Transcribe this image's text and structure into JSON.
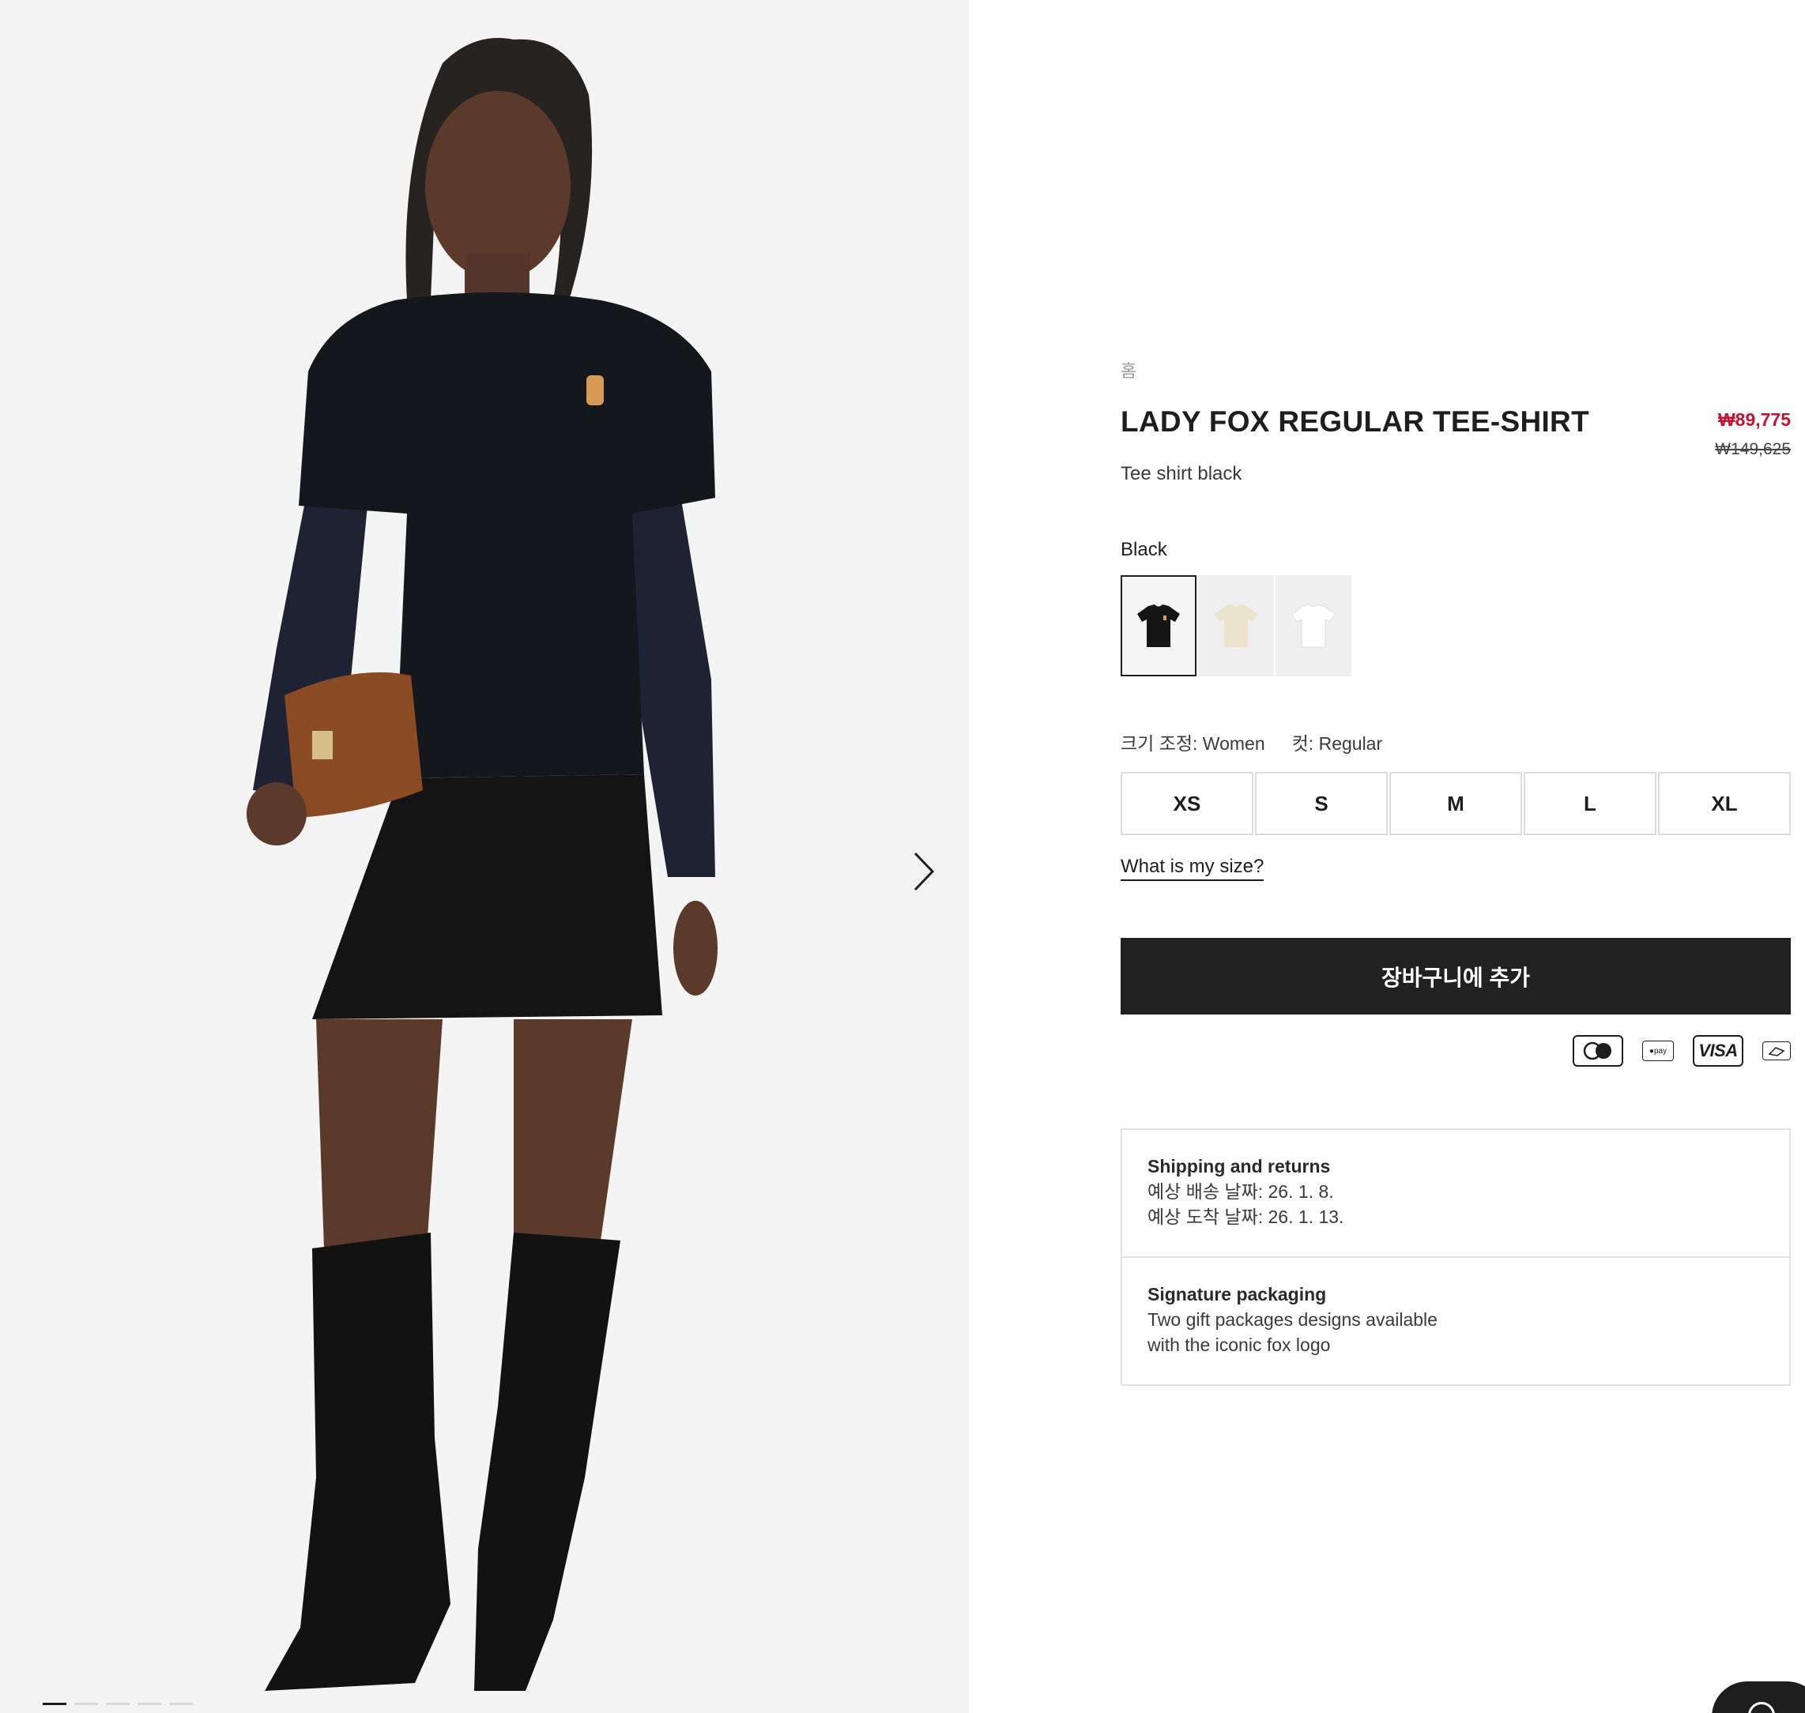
{
  "gallery": {
    "next_icon": "chevron-right-icon",
    "slides_total": 5,
    "active_slide": 1
  },
  "breadcrumb": {
    "home_label": "홈"
  },
  "product": {
    "title": "LADY FOX REGULAR TEE-SHIRT",
    "subtitle": "Tee shirt black",
    "price_sale": "₩89,775",
    "price_original": "₩149,625"
  },
  "color": {
    "selected_label": "Black",
    "swatches": [
      {
        "name": "black",
        "color": "#1a1a1a",
        "selected": true
      },
      {
        "name": "cream",
        "color": "#efe8d6",
        "selected": false
      },
      {
        "name": "white",
        "color": "#ffffff",
        "selected": false
      }
    ]
  },
  "size": {
    "fit_label": "크기 조정: Women",
    "cut_label": "컷: Regular",
    "options": [
      "XS",
      "S",
      "M",
      "L",
      "XL"
    ],
    "help_link": "What is my size?"
  },
  "cta": {
    "add_to_cart": "장바구니에 추가"
  },
  "payments": {
    "visa_label": "VISA",
    "apay_label": "●pay",
    "icons": [
      "mastercard-icon",
      "apple-pay-icon",
      "visa-icon",
      "card-icon"
    ]
  },
  "info": {
    "shipping_title": "Shipping and returns",
    "shipping_line1": "예상 배송 날짜: 26. 1. 8.",
    "shipping_line2": "예상 도착 날짜: 26. 1. 13.",
    "packaging_title": "Signature packaging",
    "packaging_line1": "Two gift packages designs available",
    "packaging_line2": "with the iconic fox logo"
  },
  "colors": {
    "accent_sale": "#c4122f",
    "button_bg": "#212121",
    "gallery_bg": "#f4f4f4"
  }
}
